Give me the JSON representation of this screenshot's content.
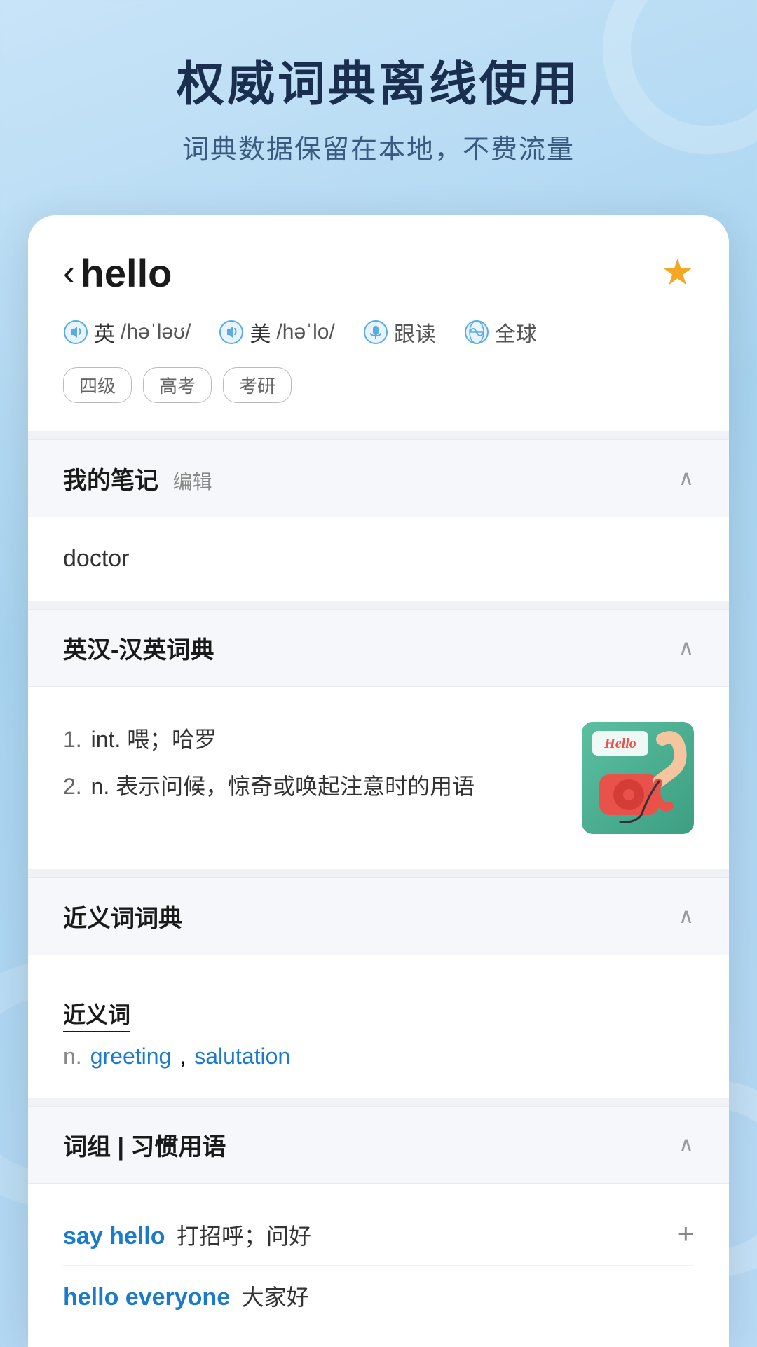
{
  "background": {
    "title": "权威词典离线使用",
    "subtitle": "词典数据保留在本地，不费流量"
  },
  "word": {
    "back_label": "‹",
    "word_text": "hello",
    "star_icon": "★",
    "pronunciations": [
      {
        "flag": "英",
        "phonetic": "/həˈləʊ/",
        "type": "uk"
      },
      {
        "flag": "美",
        "phonetic": "/həˈlo/",
        "type": "us"
      }
    ],
    "follow_read": "跟读",
    "global": "全球",
    "tags": [
      "四级",
      "高考",
      "考研"
    ]
  },
  "notes_section": {
    "title": "我的笔记",
    "edit_label": "编辑",
    "chevron": "∧",
    "content": "doctor"
  },
  "dict_section": {
    "title": "英汉-汉英词典",
    "chevron": "∧",
    "definitions": [
      {
        "number": "1.",
        "pos": "int.",
        "text": "喂；哈罗"
      },
      {
        "number": "2.",
        "pos": "n.",
        "text": "表示问候，惊奇或唤起注意时的用语"
      }
    ]
  },
  "synonym_section": {
    "title": "近义词词典",
    "chevron": "∧",
    "synonyms_label": "近义词",
    "pos": "n.",
    "words": [
      "greeting",
      "salutation"
    ]
  },
  "phrase_section": {
    "title": "词组 | 习惯用语",
    "chevron": "∧",
    "phrases": [
      {
        "en": "say hello",
        "cn": "打招呼；问好",
        "has_add": true
      },
      {
        "en": "hello everyone",
        "cn": "大家好",
        "has_add": false
      }
    ]
  }
}
